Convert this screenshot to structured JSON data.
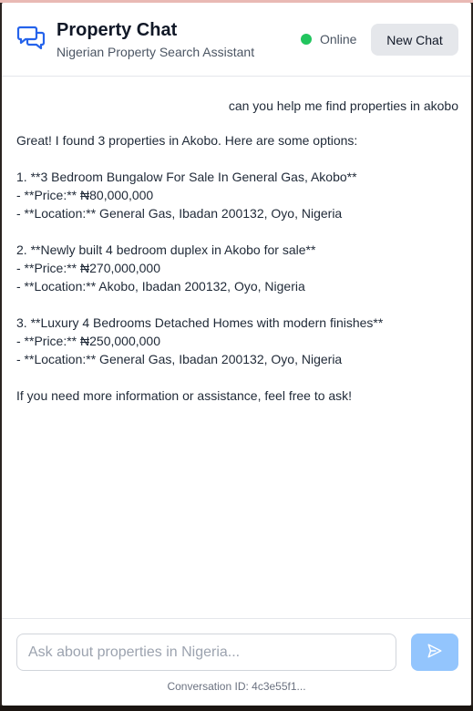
{
  "header": {
    "title": "Property Chat",
    "subtitle": "Nigerian Property Search Assistant",
    "status": "Online",
    "status_color": "#22c55e",
    "new_chat_label": "New Chat",
    "logo_icon": "chat-bubbles-icon",
    "accent_color": "#2563eb"
  },
  "messages": {
    "user": "can you help me find properties in akobo",
    "bot_lines": [
      "Great! I found 3 properties in Akobo. Here are some options:",
      "",
      "1. **3 Bedroom Bungalow For Sale In General Gas, Akobo**",
      "- **Price:** ₦80,000,000",
      "- **Location:** General Gas, Ibadan 200132, Oyo, Nigeria",
      "",
      "2. **Newly built 4 bedroom duplex in Akobo for sale**",
      "- **Price:** ₦270,000,000",
      "- **Location:** Akobo, Ibadan 200132, Oyo, Nigeria",
      "",
      "3. **Luxury 4 Bedrooms Detached Homes with modern finishes**",
      "- **Price:** ₦250,000,000",
      "- **Location:** General Gas, Ibadan 200132, Oyo, Nigeria",
      "",
      "If you need more information or assistance, feel free to ask!"
    ]
  },
  "footer": {
    "input_placeholder": "Ask about properties in Nigeria...",
    "input_value": "",
    "send_icon": "send-icon",
    "send_color": "#93c5fd",
    "conversation_id": "Conversation ID: 4c3e55f1..."
  }
}
